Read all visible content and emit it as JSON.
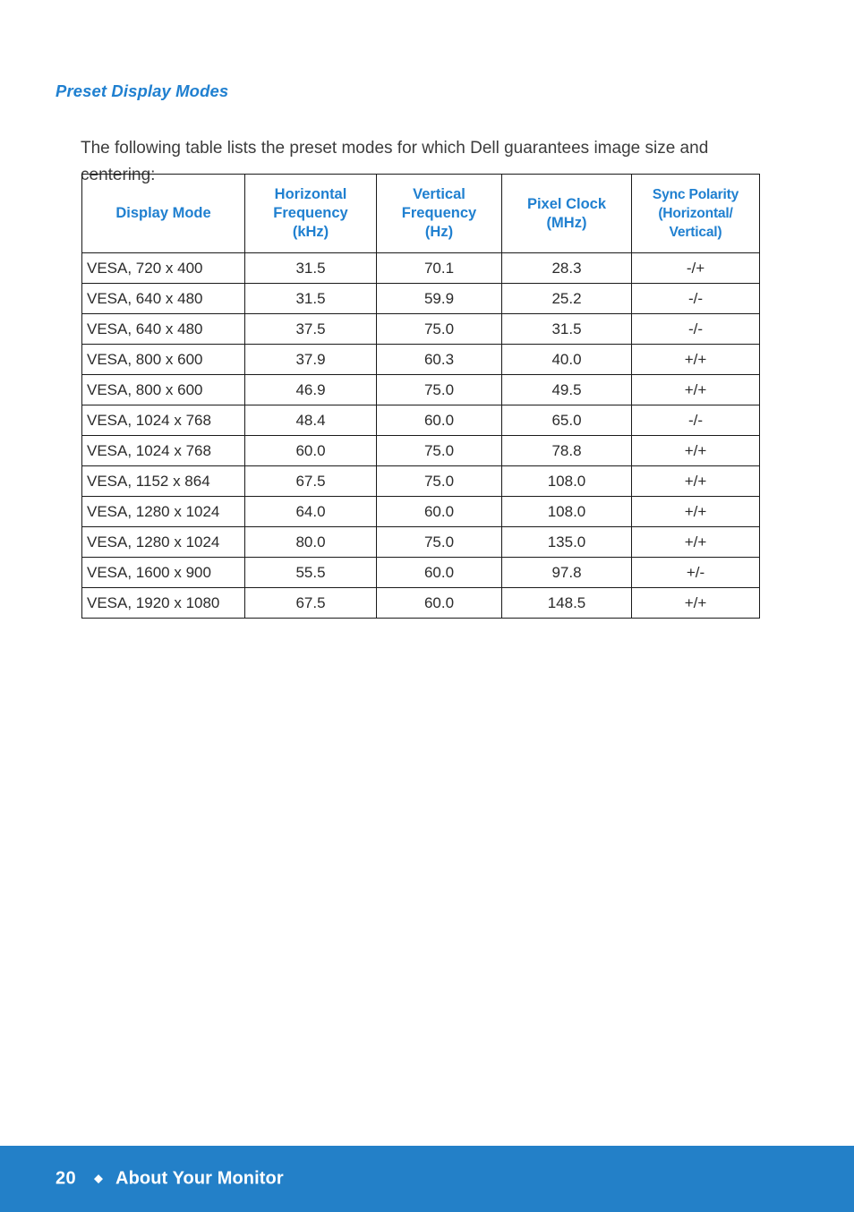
{
  "heading": "Preset Display Modes",
  "intro": "The following table lists the preset modes for which Dell guarantees image size and centering:",
  "table": {
    "headers": {
      "display_mode": "Display Mode",
      "horizontal_frequency": "Horizontal Frequency (kHz)",
      "horizontal_frequency_l1": "Horizontal",
      "horizontal_frequency_l2": "Frequency",
      "horizontal_frequency_l3": "(kHz)",
      "vertical_frequency": "Vertical Frequency (Hz)",
      "vertical_frequency_l1": "Vertical",
      "vertical_frequency_l2": "Frequency",
      "vertical_frequency_l3": "(Hz)",
      "pixel_clock": "Pixel Clock (MHz)",
      "pixel_clock_l1": "Pixel Clock",
      "pixel_clock_l2": "(MHz)",
      "sync_polarity": "Sync Polarity (Horizontal/ Vertical)",
      "sync_polarity_l1": "Sync Polarity",
      "sync_polarity_l2": "(Horizontal/",
      "sync_polarity_l3": "Vertical)"
    },
    "rows": [
      {
        "mode": "VESA, 720 x 400",
        "hfreq": "31.5",
        "vfreq": "70.1",
        "clock": "28.3",
        "sync": "-/+"
      },
      {
        "mode": "VESA, 640 x 480",
        "hfreq": "31.5",
        "vfreq": "59.9",
        "clock": "25.2",
        "sync": "-/-"
      },
      {
        "mode": "VESA, 640 x 480",
        "hfreq": "37.5",
        "vfreq": "75.0",
        "clock": "31.5",
        "sync": "-/-"
      },
      {
        "mode": "VESA, 800 x 600",
        "hfreq": "37.9",
        "vfreq": "60.3",
        "clock": "40.0",
        "sync": "+/+"
      },
      {
        "mode": "VESA, 800 x 600",
        "hfreq": "46.9",
        "vfreq": "75.0",
        "clock": "49.5",
        "sync": "+/+"
      },
      {
        "mode": "VESA, 1024 x 768",
        "hfreq": "48.4",
        "vfreq": "60.0",
        "clock": "65.0",
        "sync": "-/-"
      },
      {
        "mode": "VESA, 1024 x 768",
        "hfreq": "60.0",
        "vfreq": "75.0",
        "clock": "78.8",
        "sync": "+/+"
      },
      {
        "mode": "VESA, 1152 x 864",
        "hfreq": "67.5",
        "vfreq": "75.0",
        "clock": "108.0",
        "sync": "+/+"
      },
      {
        "mode": "VESA, 1280 x 1024",
        "hfreq": "64.0",
        "vfreq": "60.0",
        "clock": "108.0",
        "sync": "+/+"
      },
      {
        "mode": "VESA, 1280 x 1024",
        "hfreq": "80.0",
        "vfreq": "75.0",
        "clock": "135.0",
        "sync": "+/+"
      },
      {
        "mode": "VESA, 1600 x 900",
        "hfreq": "55.5",
        "vfreq": "60.0",
        "clock": "97.8",
        "sync": "+/-"
      },
      {
        "mode": "VESA, 1920 x 1080",
        "hfreq": "67.5",
        "vfreq": "60.0",
        "clock": "148.5",
        "sync": "+/+"
      }
    ]
  },
  "footer": {
    "page_number": "20",
    "separator": "◆",
    "label": "About Your Monitor"
  },
  "colors": {
    "accent_blue": "#2080d0",
    "footer_blue": "#2380c8",
    "body_text": "#3c3c3c",
    "table_border": "#1a1a1a"
  }
}
